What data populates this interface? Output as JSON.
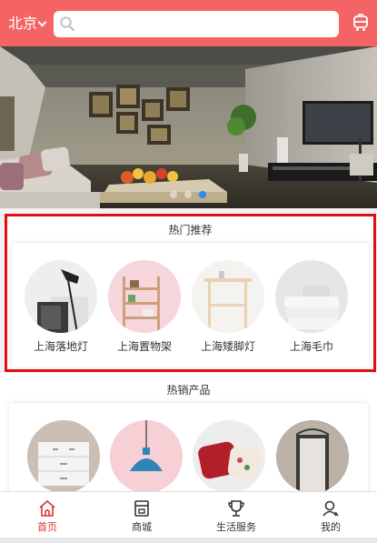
{
  "header": {
    "city": "北京",
    "search_placeholder": "",
    "colors": {
      "bar": "#f56464"
    }
  },
  "banner": {
    "dots": 3,
    "active_dot": 2
  },
  "hot_recommend": {
    "title": "热门推荐",
    "items": [
      {
        "label": "上海落地灯",
        "icon": "floor-lamp"
      },
      {
        "label": "上海置物架",
        "icon": "shelf"
      },
      {
        "label": "上海矮脚灯",
        "icon": "stool"
      },
      {
        "label": "上海毛巾",
        "icon": "towel"
      }
    ]
  },
  "hot_sale": {
    "title": "热销产品",
    "items": [
      {
        "icon": "drawer-cabinet"
      },
      {
        "icon": "pendant-lamp"
      },
      {
        "icon": "cushion"
      },
      {
        "icon": "mirror"
      }
    ]
  },
  "tabbar": {
    "tabs": [
      {
        "label": "首页",
        "icon": "home-icon",
        "active": true
      },
      {
        "label": "商城",
        "icon": "store-icon",
        "active": false
      },
      {
        "label": "生活服务",
        "icon": "trophy-icon",
        "active": false
      },
      {
        "label": "我的",
        "icon": "user-icon",
        "active": false
      }
    ],
    "active_color": "#e03030"
  }
}
